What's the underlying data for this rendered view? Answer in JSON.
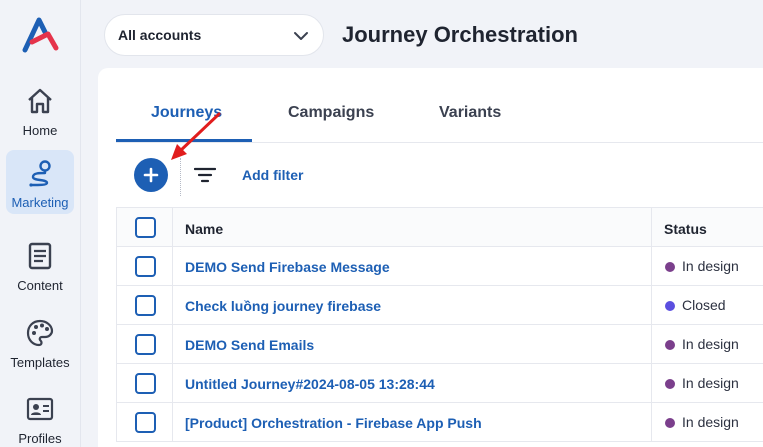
{
  "sidebar": {
    "items": [
      {
        "label": "Home",
        "icon": "home-icon"
      },
      {
        "label": "Marketing",
        "icon": "marketing-route-icon",
        "active": true
      },
      {
        "label": "Content",
        "icon": "content-document-icon"
      },
      {
        "label": "Templates",
        "icon": "palette-icon"
      },
      {
        "label": "Profiles",
        "icon": "profile-card-icon"
      }
    ]
  },
  "header": {
    "account_select": "All accounts",
    "title": "Journey Orchestration"
  },
  "tabs": [
    {
      "label": "Journeys",
      "active": true
    },
    {
      "label": "Campaigns"
    },
    {
      "label": "Variants"
    }
  ],
  "toolbar": {
    "add_filter_label": "Add filter"
  },
  "table": {
    "columns": {
      "name": "Name",
      "status": "Status"
    },
    "rows": [
      {
        "name": "DEMO Send Firebase Message",
        "status": "In design",
        "status_color": "#7b3f8c"
      },
      {
        "name": "Check luồng journey firebase",
        "status": "Closed",
        "status_color": "#5b4fe0"
      },
      {
        "name": "DEMO Send Emails",
        "status": "In design",
        "status_color": "#7b3f8c"
      },
      {
        "name": "Untitled Journey#2024-08-05 13:28:44",
        "status": "In design",
        "status_color": "#7b3f8c"
      },
      {
        "name": "[Product] Orchestration - Firebase App Push",
        "status": "In design",
        "status_color": "#7b3f8c"
      }
    ]
  },
  "colors": {
    "accent": "#1d5fb4",
    "arrow_annotation": "#e11d1d"
  }
}
